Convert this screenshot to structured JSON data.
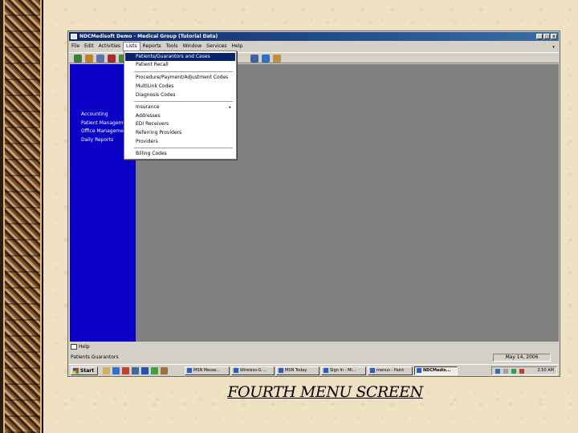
{
  "window": {
    "title": "NDCMedisoft Demo - Medical Group (Tutorial Data)",
    "controls": [
      "_",
      "□",
      "×"
    ]
  },
  "menubar": [
    "File",
    "Edit",
    "Activities",
    "Lists",
    "Reports",
    "Tools",
    "Window",
    "Services",
    "Help"
  ],
  "menubar_active": "Lists",
  "sidebar": [
    "Accounting",
    "Patient Management",
    "Office Management",
    "Daily Reports"
  ],
  "lists_menu": {
    "group1": [
      "Patients/Guarantors and Cases",
      "Patient Recall"
    ],
    "group2": [
      "Procedure/Payment/Adjustment Codes",
      "MultiLink Codes",
      "Diagnosis Codes"
    ],
    "group3": [
      "Insurance",
      "Addresses",
      "EDI Receivers",
      "Referring Providers",
      "Providers"
    ],
    "group4": [
      "Billing Codes"
    ],
    "submenu_arrow": "▸"
  },
  "helpbar": {
    "label": "Help"
  },
  "statusbar": {
    "left": "Patients Guarantors",
    "date": "May 14, 2006"
  },
  "taskbar": {
    "start": "Start",
    "tasks": [
      "MSN Messe...",
      "Wireless-G ...",
      "MSN Today",
      "Sign In - Mi...",
      "menus - Paint",
      "NDCMedis..."
    ],
    "clock": "2:50 AM"
  },
  "caption": "FOURTH MENU SCREEN",
  "colors": {
    "sidebar": "#0b00c6",
    "titlebar": "#0a246a",
    "workspace": "#808080"
  }
}
